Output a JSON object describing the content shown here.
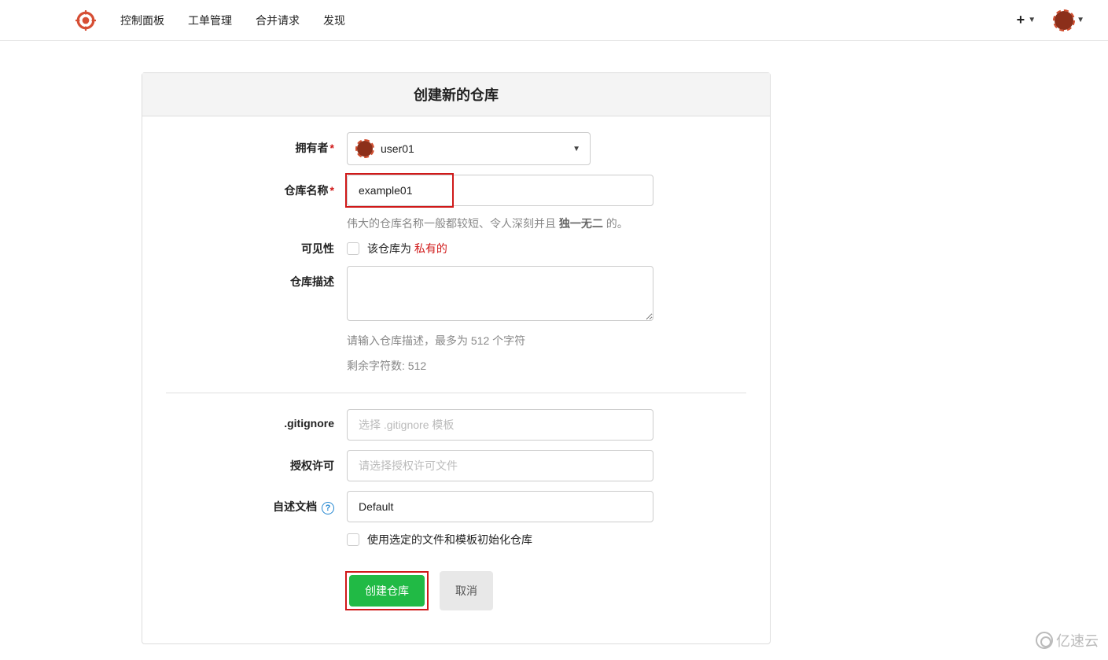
{
  "nav": {
    "items": [
      "控制面板",
      "工单管理",
      "合并请求",
      "发现"
    ]
  },
  "form": {
    "title": "创建新的仓库",
    "owner_label": "拥有者",
    "owner_value": "user01",
    "repo_name_label": "仓库名称",
    "repo_name_value": "example01",
    "repo_name_hint_prefix": "伟大的仓库名称一般都较短、令人深刻并且 ",
    "repo_name_hint_bold": "独一无二",
    "repo_name_hint_suffix": " 的。",
    "visibility_label": "可见性",
    "visibility_text_prefix": "该仓库为 ",
    "visibility_text_private": "私有的",
    "description_label": "仓库描述",
    "description_hint": "请输入仓库描述，最多为 512 个字符",
    "description_remaining": "剩余字符数: 512",
    "gitignore_label": ".gitignore",
    "gitignore_placeholder": "选择 .gitignore 模板",
    "license_label": "授权许可",
    "license_placeholder": "请选择授权许可文件",
    "readme_label": "自述文档",
    "readme_value": "Default",
    "init_checkbox_label": "使用选定的文件和模板初始化仓库",
    "submit_button": "创建仓库",
    "cancel_button": "取消"
  },
  "watermark": "亿速云"
}
